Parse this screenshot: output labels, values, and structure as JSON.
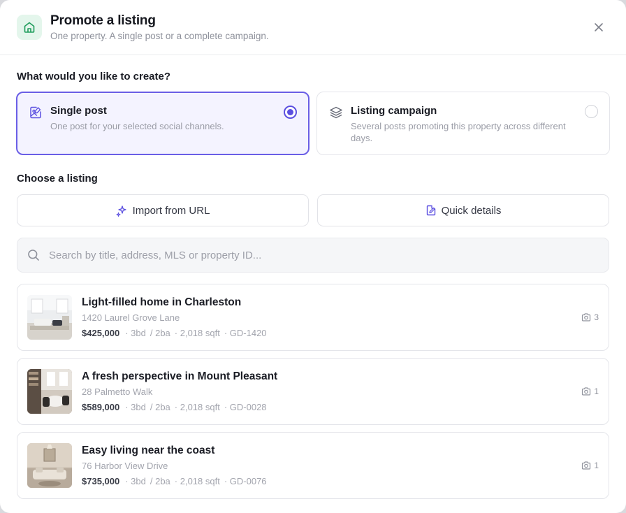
{
  "header": {
    "title": "Promote a listing",
    "subtitle": "One property. A single post or a complete campaign.",
    "accent_color": "#1f9d5c"
  },
  "create_section": {
    "label": "What would you like to create?",
    "options": [
      {
        "title": "Single post",
        "description": "One post for your selected social channels.",
        "selected": true,
        "icon": "image-edit-icon"
      },
      {
        "title": "Listing campaign",
        "description": "Several posts promoting this property across different days.",
        "selected": false,
        "icon": "layers-icon"
      }
    ]
  },
  "listing_section": {
    "label": "Choose a listing",
    "import_button": "Import from URL",
    "quick_button": "Quick details",
    "search_placeholder": "Search by title, address, MLS or property ID..."
  },
  "listings": [
    {
      "title": "Light-filled home in Charleston",
      "address": "1420 Laurel Grove Lane",
      "price": "$425,000",
      "beds": "· 3bd",
      "baths": "/ 2ba",
      "sqft": "· 2,018 sqft",
      "id": "· GD-1420",
      "photos": "3"
    },
    {
      "title": "A fresh perspective in Mount Pleasant",
      "address": "28 Palmetto Walk",
      "price": "$589,000",
      "beds": "· 3bd",
      "baths": "/ 2ba",
      "sqft": "· 2,018 sqft",
      "id": "· GD-0028",
      "photos": "1"
    },
    {
      "title": "Easy living near the coast",
      "address": "76 Harbor View Drive",
      "price": "$735,000",
      "beds": "· 3bd",
      "baths": "/ 2ba",
      "sqft": "· 2,018 sqft",
      "id": "· GD-0076",
      "photos": "1"
    }
  ],
  "colors": {
    "selected_border": "#6a5ee6",
    "selected_bg": "#f4f3ff",
    "radio_on": "#5b4fe0"
  }
}
